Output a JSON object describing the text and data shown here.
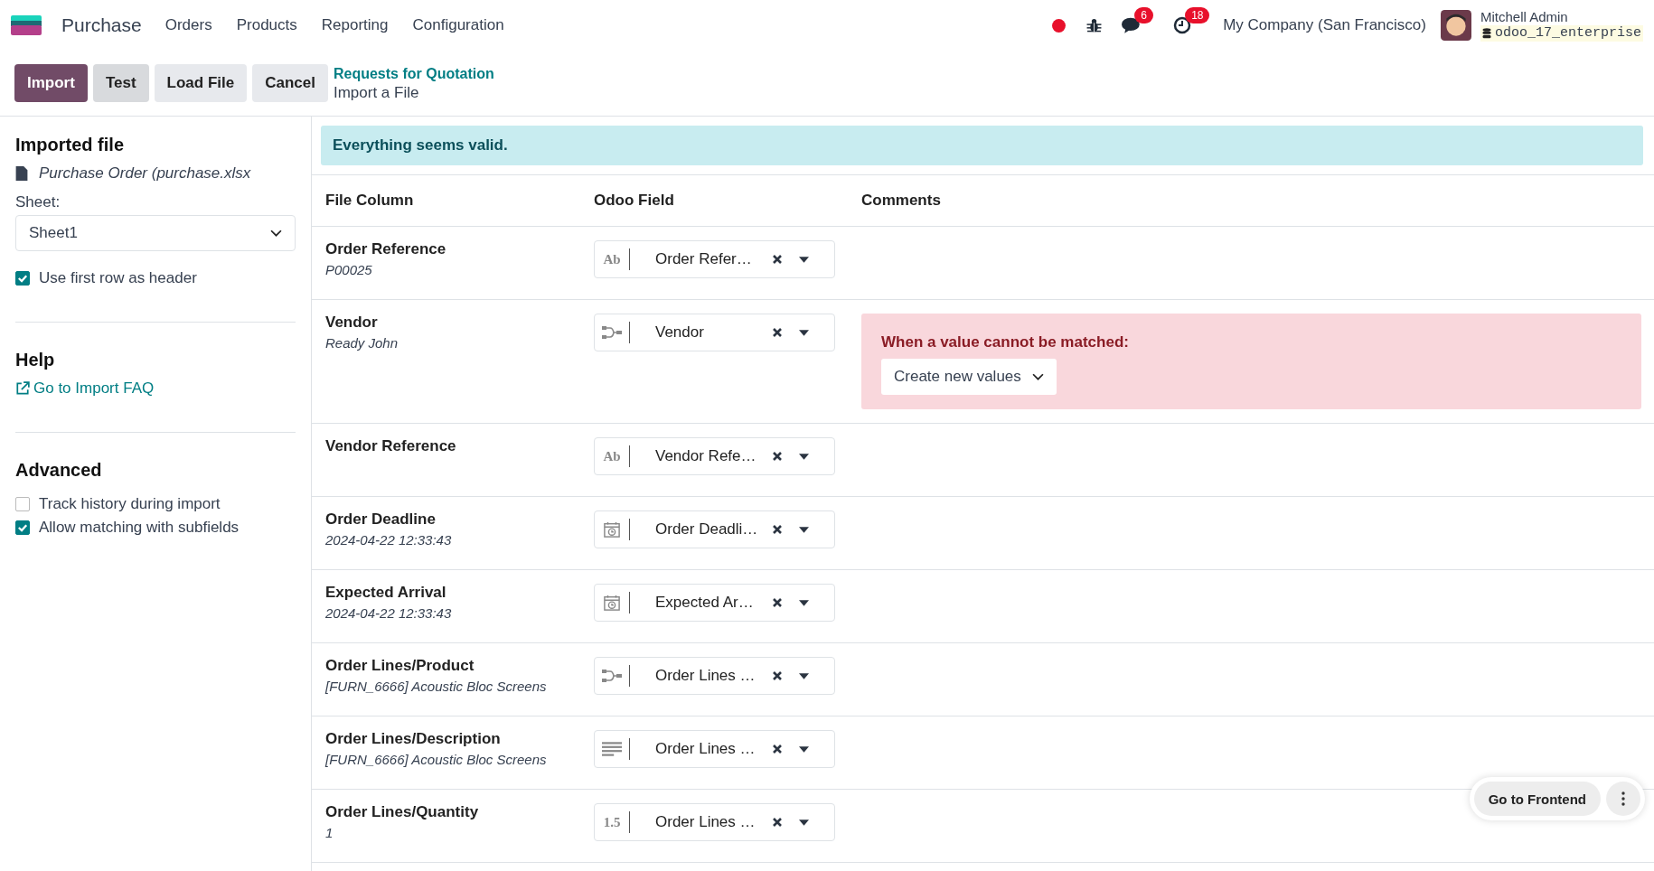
{
  "navbar": {
    "app_name": "Purchase",
    "menu": [
      "Orders",
      "Products",
      "Reporting",
      "Configuration"
    ],
    "messages_count": "6",
    "activities_count": "18",
    "company": "My Company (San Francisco)",
    "user_name": "Mitchell Admin",
    "database": "odoo_17_enterprise"
  },
  "control_panel": {
    "buttons": [
      {
        "label": "Import",
        "kind": "primary"
      },
      {
        "label": "Test",
        "kind": "secondary"
      },
      {
        "label": "Load File",
        "kind": "light"
      },
      {
        "label": "Cancel",
        "kind": "light"
      }
    ],
    "breadcrumb": "Requests for Quotation",
    "title": "Import a File"
  },
  "sidebar": {
    "imported_file_title": "Imported file",
    "file_name": "Purchase Order (purchase.xlsx",
    "sheet_label": "Sheet:",
    "sheet_value": "Sheet1",
    "header_option": {
      "label": "Use first row as header",
      "checked": true
    },
    "help_title": "Help",
    "faq_link": "Go to Import FAQ",
    "advanced_title": "Advanced",
    "advanced_options": [
      {
        "label": "Track history during import",
        "checked": false
      },
      {
        "label": "Allow matching with subfields",
        "checked": true
      }
    ]
  },
  "alert": "Everything seems valid.",
  "table": {
    "columns": [
      "File Column",
      "Odoo Field",
      "Comments"
    ],
    "rows": [
      {
        "column": "Order Reference",
        "sample": "P00025",
        "field": "Order Refer…",
        "kind": "text",
        "icon_text": "Ab"
      },
      {
        "column": "Vendor",
        "sample": "Ready John",
        "field": "Vendor",
        "kind": "relation",
        "comment": {
          "title": "When a value cannot be matched:",
          "option": "Create new values"
        }
      },
      {
        "column": "Vendor Reference",
        "field": "Vendor Refe…",
        "kind": "text",
        "icon_text": "Ab"
      },
      {
        "column": "Order Deadline",
        "sample": "2024-04-22 12:33:43",
        "field": "Order Deadli…",
        "kind": "date"
      },
      {
        "column": "Expected Arrival",
        "sample": "2024-04-22 12:33:43",
        "field": "Expected Ar…",
        "kind": "date"
      },
      {
        "column": "Order Lines/Product",
        "sample": "[FURN_6666] Acoustic Bloc Screens",
        "field": "Order Lines …",
        "kind": "relation"
      },
      {
        "column": "Order Lines/Description",
        "sample": "[FURN_6666] Acoustic Bloc Screens",
        "field": "Order Lines …",
        "kind": "multiline"
      },
      {
        "column": "Order Lines/Quantity",
        "sample": "1",
        "field": "Order Lines …",
        "kind": "number",
        "icon_text": "1.5"
      }
    ]
  },
  "frontend_button": "Go to Frontend"
}
